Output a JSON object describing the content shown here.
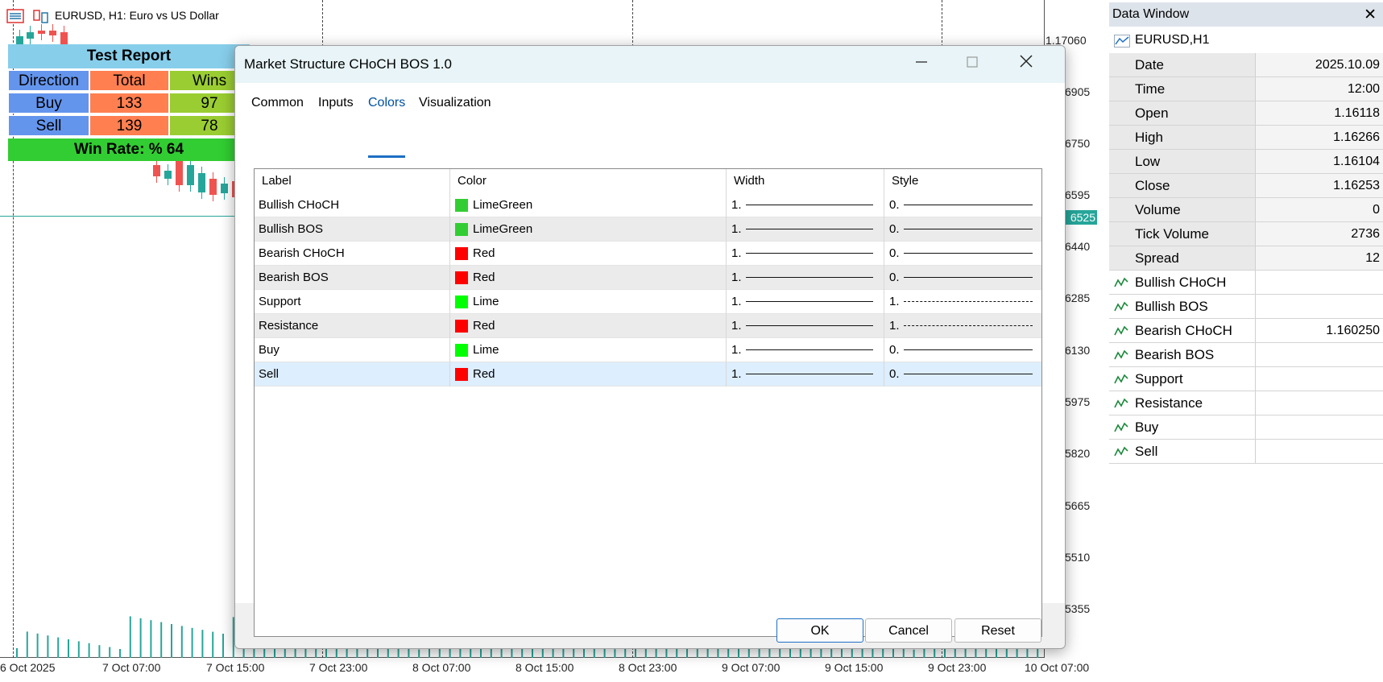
{
  "chart": {
    "title": "EURUSD, H1:  Euro vs US Dollar",
    "prices": [
      "1.17060",
      "6905",
      "6750",
      "6595",
      "6440",
      "6285",
      "6130",
      "5975",
      "5820",
      "5665",
      "5510",
      "5355"
    ],
    "current_price": "6525",
    "times": [
      "6 Oct 2025",
      "7 Oct 07:00",
      "7 Oct 15:00",
      "7 Oct 23:00",
      "8 Oct 07:00",
      "8 Oct 15:00",
      "8 Oct 23:00",
      "9 Oct 07:00",
      "9 Oct 15:00",
      "9 Oct 23:00",
      "10 Oct 07:00"
    ],
    "colors": {
      "bull": "#26a69a",
      "bear": "#ef5350",
      "accent": "#26a69a"
    }
  },
  "report": {
    "title": "Test Report",
    "headers": [
      "Direction",
      "Total",
      "Wins"
    ],
    "rows": [
      [
        "Buy",
        "133",
        "97"
      ],
      [
        "Sell",
        "139",
        "78"
      ]
    ],
    "win_rate": "Win Rate: %  64"
  },
  "dialog": {
    "title": "Market Structure CHoCH BOS 1.0",
    "tabs": [
      "Common",
      "Inputs",
      "Colors",
      "Visualization"
    ],
    "active_tab": "Colors",
    "columns": [
      "Label",
      "Color",
      "Width",
      "Style"
    ],
    "rows": [
      {
        "label": "Bullish CHoCH",
        "color_name": "LimeGreen",
        "color": "#32cd32",
        "width": "1.",
        "style": "0.",
        "dashed": false
      },
      {
        "label": "Bullish BOS",
        "color_name": "LimeGreen",
        "color": "#32cd32",
        "width": "1.",
        "style": "0.",
        "dashed": false
      },
      {
        "label": "Bearish CHoCH",
        "color_name": "Red",
        "color": "#ff0000",
        "width": "1.",
        "style": "0.",
        "dashed": false
      },
      {
        "label": "Bearish BOS",
        "color_name": "Red",
        "color": "#ff0000",
        "width": "1.",
        "style": "0.",
        "dashed": false
      },
      {
        "label": "Support",
        "color_name": "Lime",
        "color": "#00ff00",
        "width": "1.",
        "style": "1.",
        "dashed": true
      },
      {
        "label": "Resistance",
        "color_name": "Red",
        "color": "#ff0000",
        "width": "1.",
        "style": "1.",
        "dashed": true
      },
      {
        "label": "Buy",
        "color_name": "Lime",
        "color": "#00ff00",
        "width": "1.",
        "style": "0.",
        "dashed": false
      },
      {
        "label": "Sell",
        "color_name": "Red",
        "color": "#ff0000",
        "width": "1.",
        "style": "0.",
        "dashed": false
      }
    ],
    "buttons": {
      "ok": "OK",
      "cancel": "Cancel",
      "reset": "Reset"
    }
  },
  "datawindow": {
    "title": "Data Window",
    "close": "✕",
    "symbol": "EURUSD,H1",
    "rows": [
      {
        "label": "Date",
        "value": "2025.10.09"
      },
      {
        "label": "Time",
        "value": "12:00"
      },
      {
        "label": "Open",
        "value": "1.16118"
      },
      {
        "label": "High",
        "value": "1.16266"
      },
      {
        "label": "Low",
        "value": "1.16104"
      },
      {
        "label": "Close",
        "value": "1.16253"
      },
      {
        "label": "Volume",
        "value": "0"
      },
      {
        "label": "Tick Volume",
        "value": "2736"
      },
      {
        "label": "Spread",
        "value": "12"
      }
    ],
    "indicators": [
      {
        "label": "Bullish CHoCH",
        "value": ""
      },
      {
        "label": "Bullish BOS",
        "value": ""
      },
      {
        "label": "Bearish CHoCH",
        "value": "1.160250"
      },
      {
        "label": "Bearish BOS",
        "value": ""
      },
      {
        "label": "Support",
        "value": ""
      },
      {
        "label": "Resistance",
        "value": ""
      },
      {
        "label": "Buy",
        "value": ""
      },
      {
        "label": "Sell",
        "value": ""
      }
    ]
  }
}
